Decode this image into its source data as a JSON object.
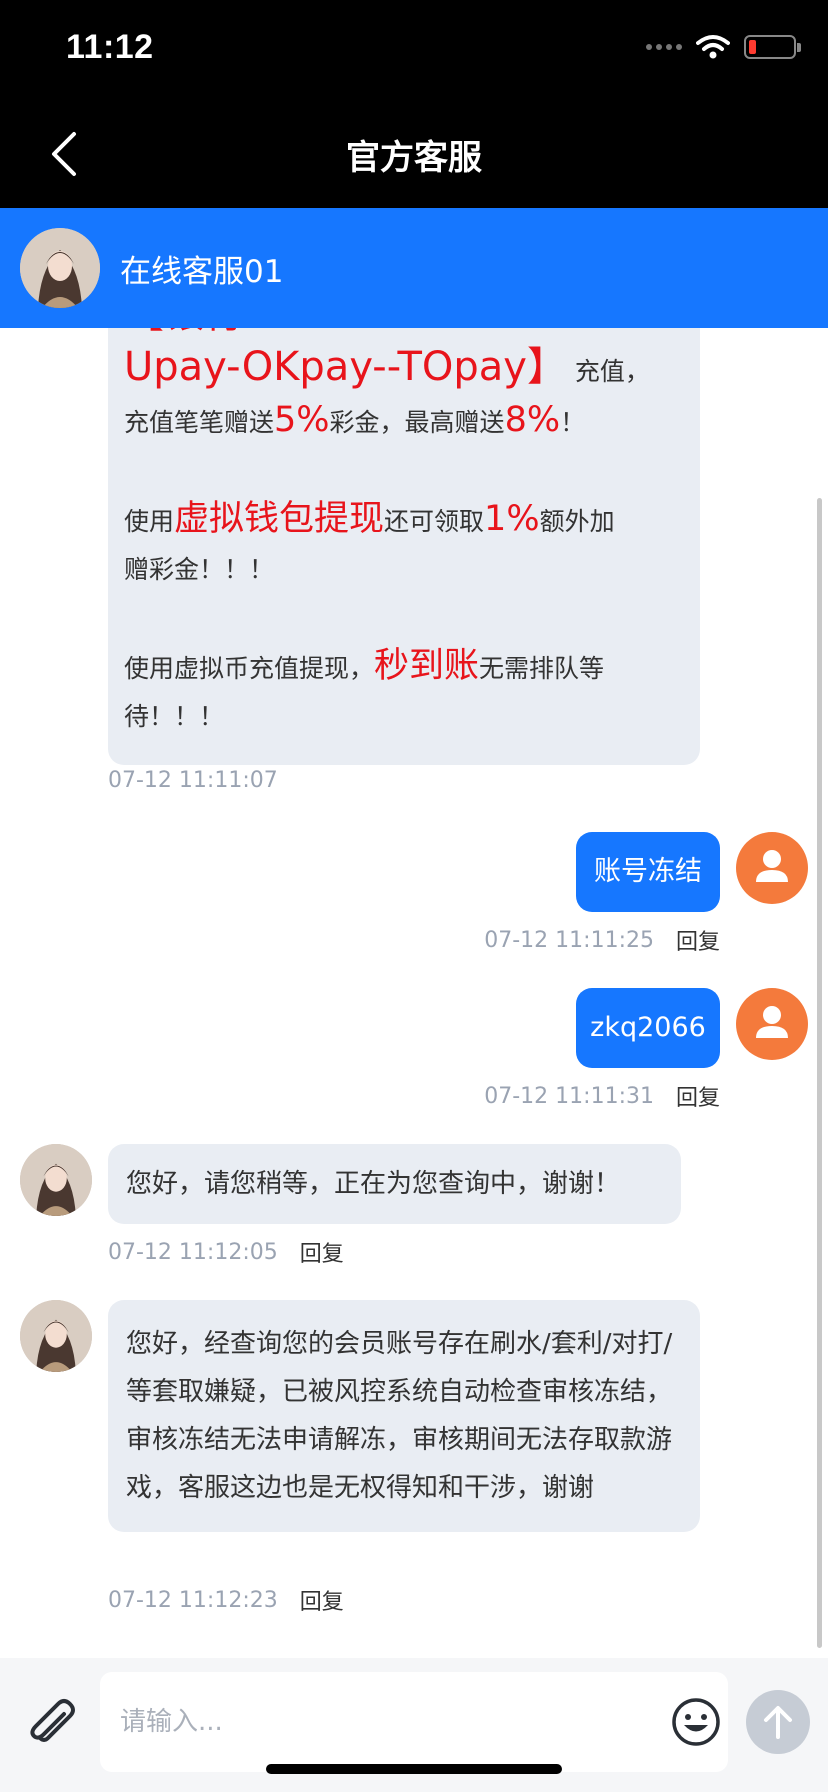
{
  "status_bar": {
    "time": "11:12",
    "battery_level": 0.15
  },
  "nav": {
    "title": "官方客服"
  },
  "agent": {
    "name": "在线客服01"
  },
  "messages": {
    "promo": {
      "top_clip_red": "【银行",
      "line1_red": "Upay-OKpay--TOpay】",
      "line1_tail": "充值，",
      "line2_a": "充值笔笔赠送",
      "line2_pct1": "5%",
      "line2_b": "彩金，最高赠送",
      "line2_pct2": "8%",
      "line2_c": "！",
      "line3_a": "使用",
      "line3_red": "虚拟钱包提现",
      "line3_b": "还可领取",
      "line3_pct": "1%",
      "line3_c": "额外加",
      "line4": "赠彩金！！！",
      "line5_a": "使用虚拟币充值提现，",
      "line5_red": "秒到账",
      "line5_b": "无需排队等",
      "line6": "待！！！",
      "time": "07-12 11:11:07"
    },
    "user1": {
      "text": "账号冻结",
      "time": "07-12 11:11:25",
      "reply": "回复"
    },
    "user2": {
      "text": "zkq2066",
      "time": "07-12 11:11:31",
      "reply": "回复"
    },
    "agent1": {
      "text": "您好，请您稍等，正在为您查询中，谢谢！",
      "time": "07-12 11:12:05",
      "reply": "回复"
    },
    "agent2": {
      "text": "您好，经查询您的会员账号存在刷水/套利/对打/等套取嫌疑，已被风控系统自动检查审核冻结，审核冻结无法申请解冻，审核期间无法存取款游戏，客服这边也是无权得知和干涉，谢谢",
      "time": "07-12 11:12:23",
      "reply": "回复"
    }
  },
  "input": {
    "placeholder": "请输入..."
  },
  "icons": {
    "back": "chevron-left-icon",
    "attach": "paperclip-icon",
    "emoji": "smiley-icon",
    "send": "arrow-up-icon",
    "user": "user-icon"
  },
  "colors": {
    "brand": "#1677ff",
    "promo_red": "#e8141b",
    "user_avatar": "#f47a3c"
  }
}
